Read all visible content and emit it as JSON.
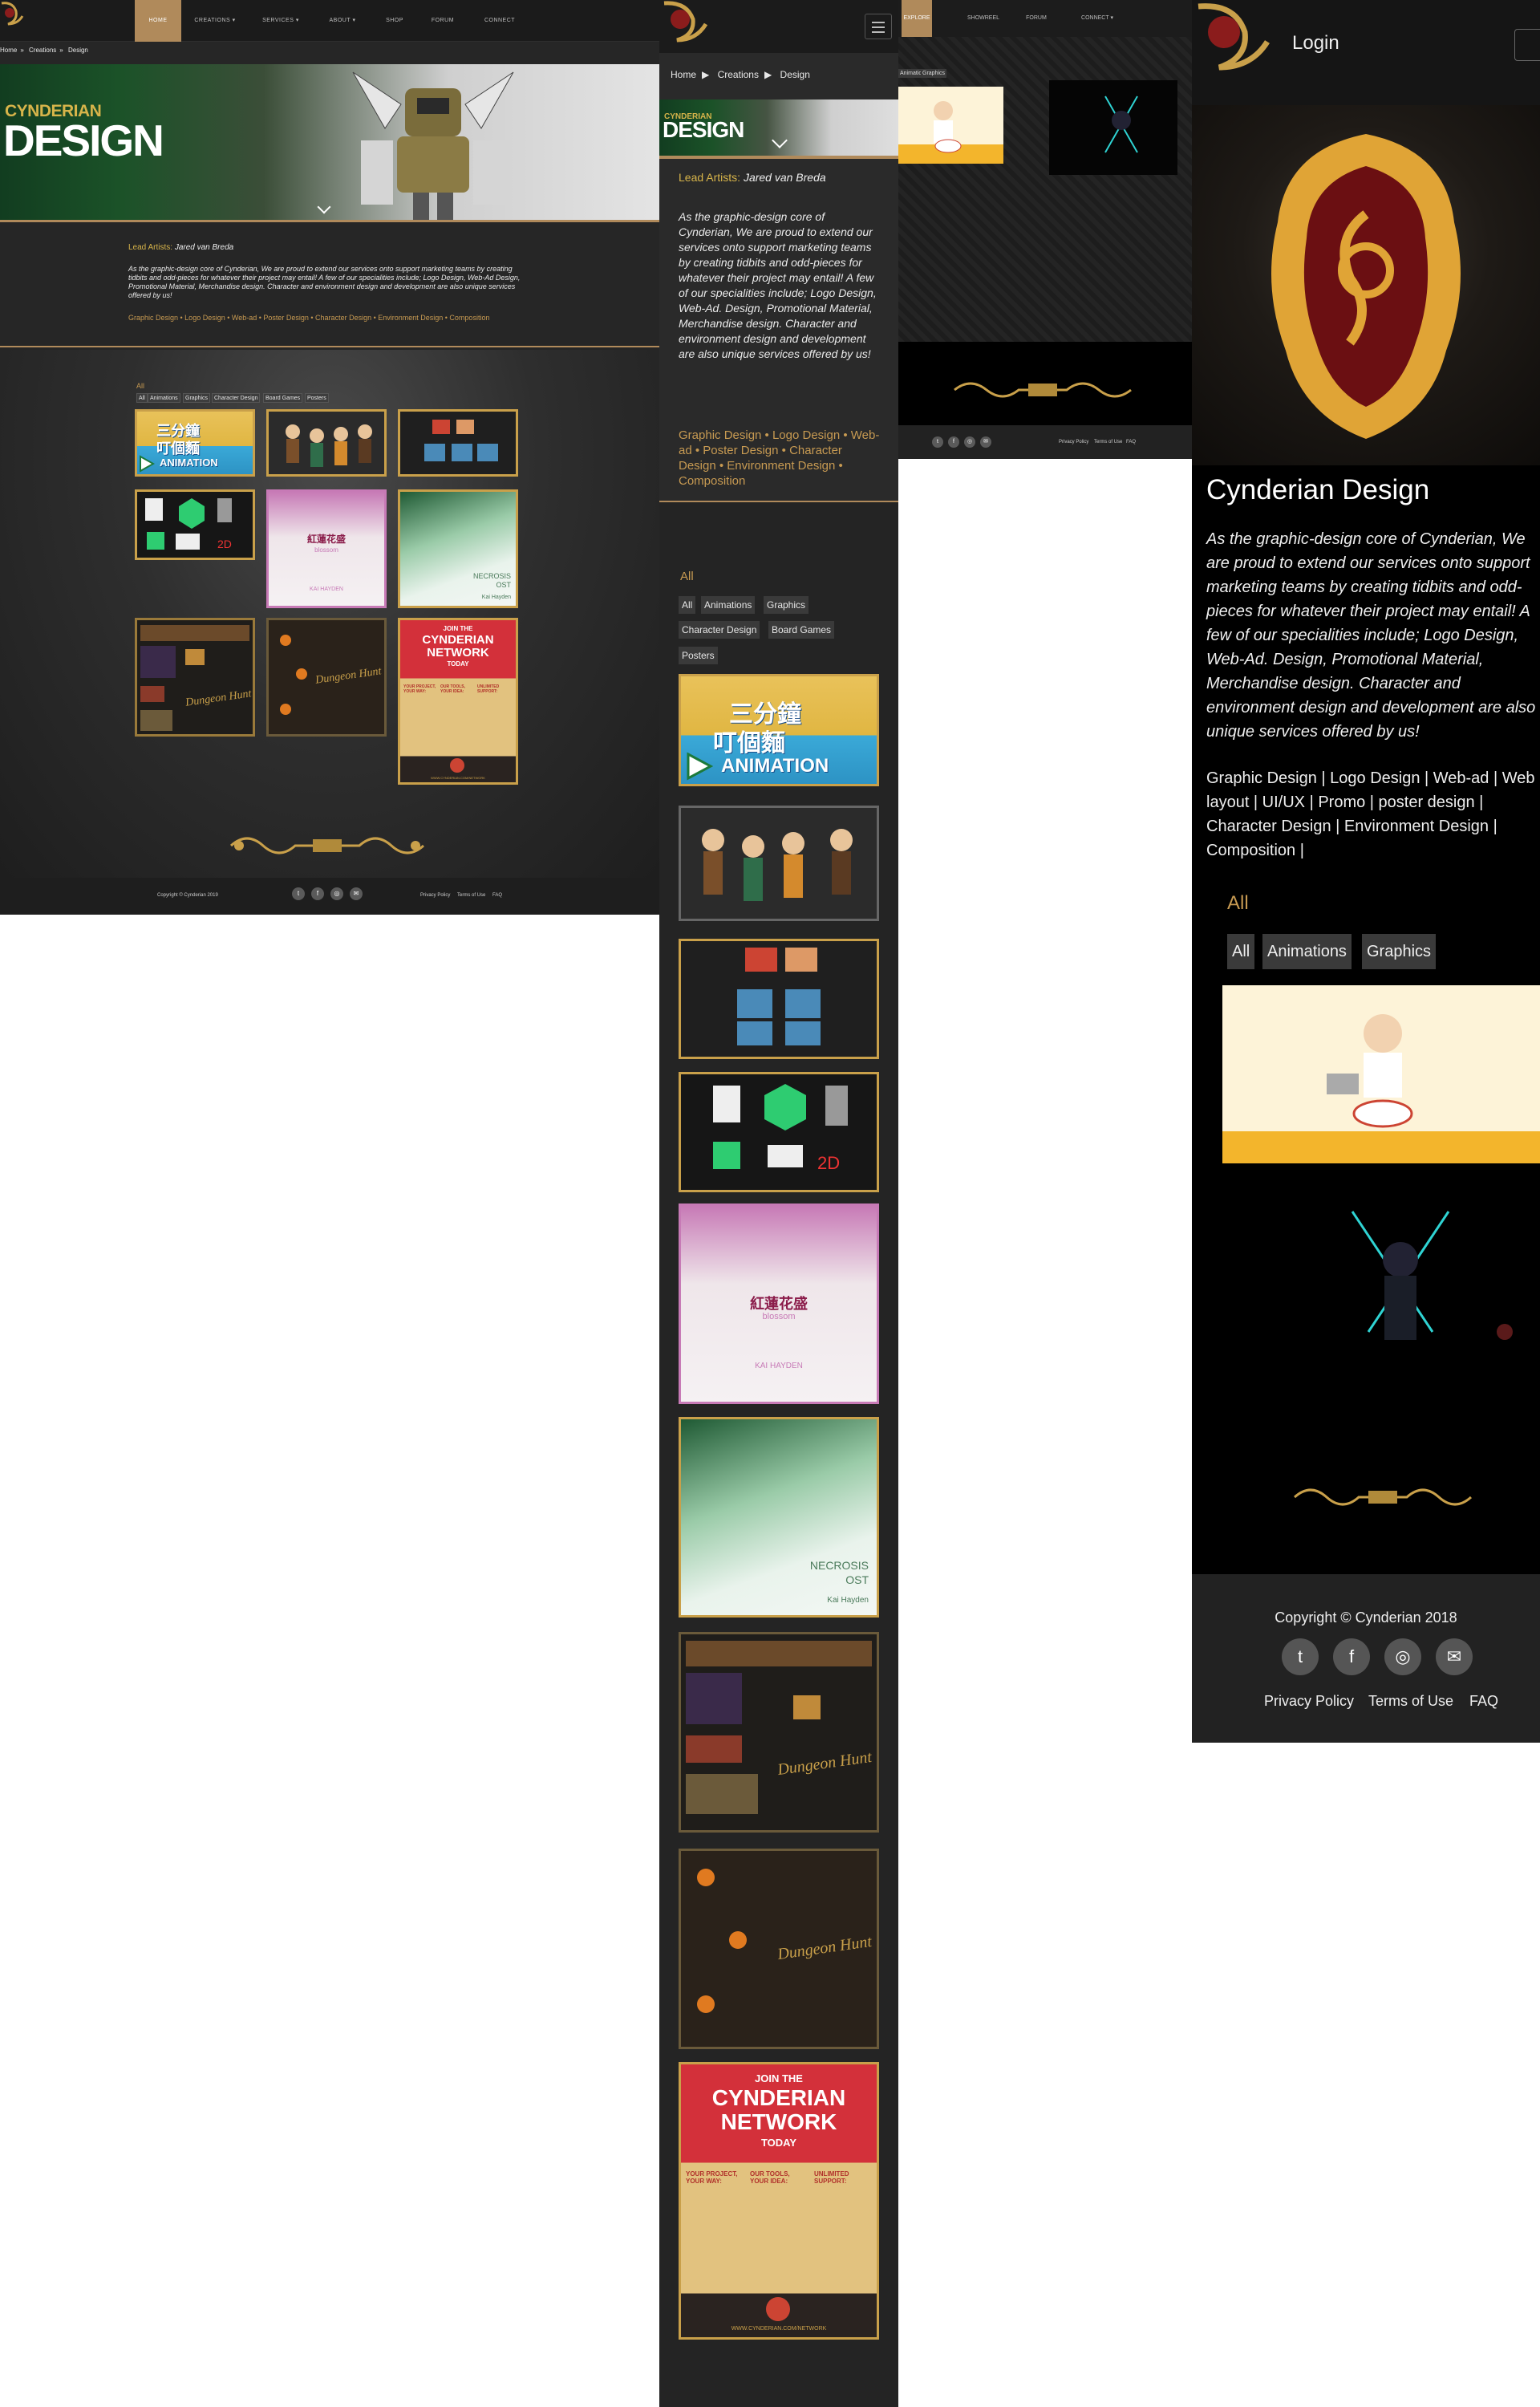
{
  "desktop": {
    "nav": [
      "HOME",
      "CREATIONS",
      "SERVICES",
      "ABOUT",
      "SHOP",
      "FORUM",
      "CONNECT"
    ],
    "breadcrumb": [
      "Home",
      "Creations",
      "Design"
    ],
    "hero": {
      "sub": "CYNDERIAN",
      "big": "DESIGN"
    },
    "lead_label": "Lead Artists:",
    "lead_name": "Jared van Breda",
    "description": "As the graphic-design core of Cynderian, We are proud to extend our services onto support marketing teams by creating tidbits and odd-pieces for whatever their project may entail! A few of our specialities include; Logo Design, Web-Ad Design, Promotional Material, Merchandise design. Character and environment design and development are also unique services offered by us!",
    "tags": "Graphic Design • Logo Design • Web-ad • Poster Design • Character Design • Environment Design • Composition",
    "all_label": "All",
    "filters": [
      "All",
      "Animations",
      "Graphics",
      "Character Design",
      "Board Games",
      "Posters"
    ],
    "footer": {
      "copyright": "Copyright © Cynderian 2019",
      "links": [
        "Privacy Policy",
        "Terms of Use",
        "FAQ"
      ]
    }
  },
  "mobile": {
    "breadcrumb": [
      "Home",
      "Creations",
      "Design"
    ],
    "hero": {
      "sub": "CYNDERIAN",
      "big": "DESIGN"
    },
    "lead_label": "Lead Artists:",
    "lead_name": "Jared van Breda",
    "description": "As the graphic-design core of Cynderian, We are proud to extend our services onto support marketing teams by creating tidbits and odd-pieces for whatever their project may entail! A few of our specialities include; Logo Design, Web-Ad. Design, Promotional Material, Merchandise design. Character and environment design and development are also unique services offered by us!",
    "tags": "Graphic Design • Logo Design • Web-ad • Poster Design • Character Design • Environment Design • Composition",
    "all_label": "All",
    "filters": [
      "All",
      "Animations",
      "Graphics",
      "Character Design",
      "Board Games",
      "Posters"
    ]
  },
  "tablet": {
    "nav": [
      "EXPLORE",
      "SHOWREEL",
      "FORUM",
      "CONNECT"
    ],
    "filters": [
      "Animations",
      "Graphics"
    ],
    "footer_links": [
      "Privacy Policy",
      "Terms of Use",
      "FAQ"
    ]
  },
  "phone": {
    "login": "Login",
    "title": "Cynderian Design",
    "description": "As the graphic-design core of Cynderian, We are proud to extend our services onto support marketing teams by creating tidbits and odd-pieces for whatever their project may entail! A few of our specialities include; Logo Design, Web-Ad. Design, Promotional Material, Merchandise design. Character and environment design and development are also unique services offered by us!",
    "tags": "Graphic Design | Logo Design | Web-ad | Web layout | UI/UX | Promo | poster design | Character Design | Environment Design | Composition |",
    "all_label": "All",
    "filters": [
      "All",
      "Animations",
      "Graphics"
    ],
    "footer": {
      "copyright": "Copyright © Cynderian 2018",
      "links": [
        "Privacy Policy",
        "Terms of Use",
        "FAQ"
      ]
    }
  },
  "thumbs": {
    "anim_line1": "三分鐘",
    "anim_line2": "叮個麵",
    "anim_tag": "ANIMATION",
    "pink_title": "紅蓮花盛",
    "pink_sub": "blossom",
    "pink_artist": "KAI HAYDEN",
    "green_title": "NECROSIS",
    "green_sub": "OST",
    "green_artist": "Kai Hayden",
    "dungeon": "Dungeon Hunt",
    "net_top": "JOIN THE",
    "net_mid1": "CYNDERIAN",
    "net_mid2": "NETWORK",
    "net_bot": "TODAY",
    "net_cols": [
      "YOUR PROJECT, YOUR WAY:",
      "OUR TOOLS, YOUR IDEA:",
      "UNLIMITED SUPPORT:"
    ],
    "net_url": "WWW.CYNDERIAN.COM/NETWORK"
  },
  "icons": [
    "twitter-icon",
    "facebook-icon",
    "instagram-icon",
    "email-icon",
    "hamburger-icon",
    "chevron-down-icon",
    "logo-emblem"
  ]
}
